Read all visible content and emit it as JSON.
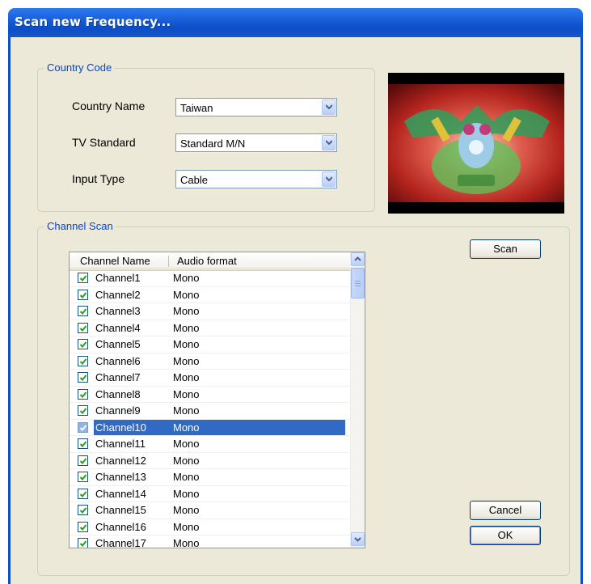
{
  "window": {
    "title": "Scan new Frequency..."
  },
  "country_code": {
    "legend": "Country Code",
    "fields": [
      {
        "label": "Country Name",
        "value": "Taiwan"
      },
      {
        "label": "TV Standard",
        "value": "Standard M/N"
      },
      {
        "label": "Input Type",
        "value": "Cable"
      }
    ]
  },
  "channel_scan": {
    "legend": "Channel Scan",
    "columns": [
      "Channel Name",
      "Audio format"
    ],
    "rows": [
      {
        "name": "Channel1",
        "audio": "Mono",
        "checked": true
      },
      {
        "name": "Channel2",
        "audio": "Mono",
        "checked": true
      },
      {
        "name": "Channel3",
        "audio": "Mono",
        "checked": true
      },
      {
        "name": "Channel4",
        "audio": "Mono",
        "checked": true
      },
      {
        "name": "Channel5",
        "audio": "Mono",
        "checked": true
      },
      {
        "name": "Channel6",
        "audio": "Mono",
        "checked": true
      },
      {
        "name": "Channel7",
        "audio": "Mono",
        "checked": true
      },
      {
        "name": "Channel8",
        "audio": "Mono",
        "checked": true
      },
      {
        "name": "Channel9",
        "audio": "Mono",
        "checked": true
      },
      {
        "name": "Channel10",
        "audio": "Mono",
        "checked": true,
        "selected": true
      },
      {
        "name": "Channel11",
        "audio": "Mono",
        "checked": true
      },
      {
        "name": "Channel12",
        "audio": "Mono",
        "checked": true
      },
      {
        "name": "Channel13",
        "audio": "Mono",
        "checked": true
      },
      {
        "name": "Channel14",
        "audio": "Mono",
        "checked": true
      },
      {
        "name": "Channel15",
        "audio": "Mono",
        "checked": true
      },
      {
        "name": "Channel16",
        "audio": "Mono",
        "checked": true
      },
      {
        "name": "Channel17",
        "audio": "Mono",
        "checked": true
      }
    ]
  },
  "buttons": {
    "scan": "Scan",
    "cancel": "Cancel",
    "ok": "OK"
  },
  "colors": {
    "title_bar": "#0b4ec7",
    "legend_text": "#0046d5",
    "selection": "#316ac5",
    "dialog_bg": "#ece9d8"
  }
}
